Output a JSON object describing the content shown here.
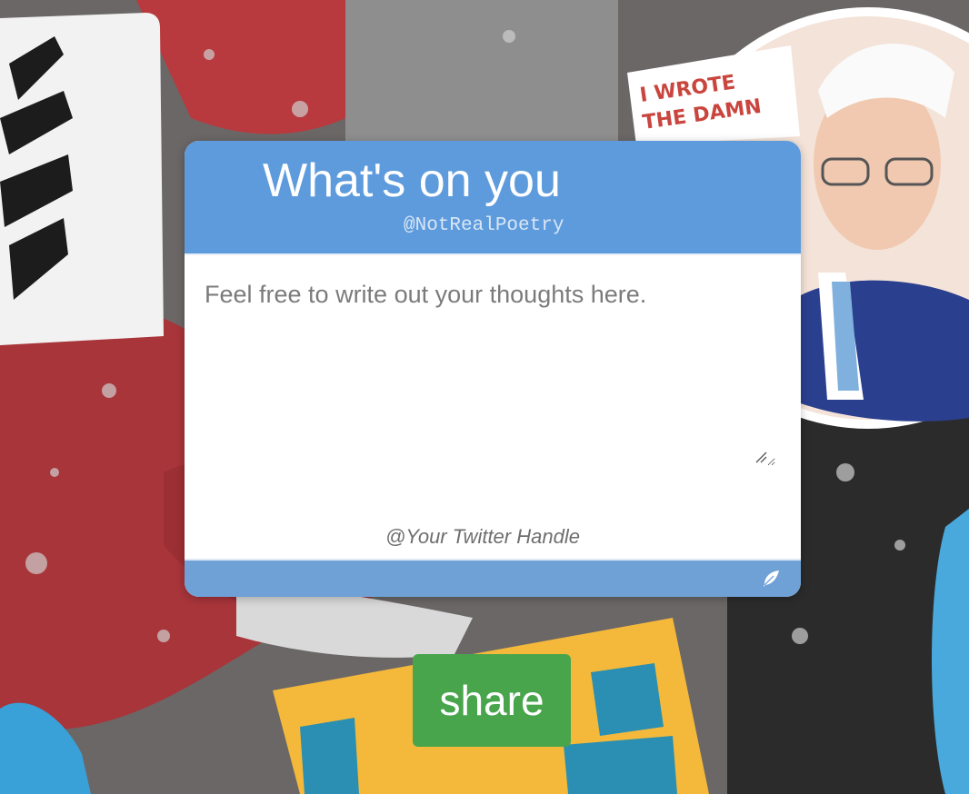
{
  "card": {
    "title": "What's on you",
    "subtitle": "@NotRealPoetry",
    "thoughts_placeholder": "Feel free to write out your thoughts here.",
    "handle_placeholder": "@Your Twitter Handle",
    "feather_icon": "feather-icon"
  },
  "share": {
    "label": "share"
  },
  "background": {
    "sticker_text_1": "I WROTE",
    "sticker_text_2": "THE DAMN"
  },
  "colors": {
    "header": "#5e9bdc",
    "footer": "#6fa1d6",
    "share": "#48a54c"
  }
}
